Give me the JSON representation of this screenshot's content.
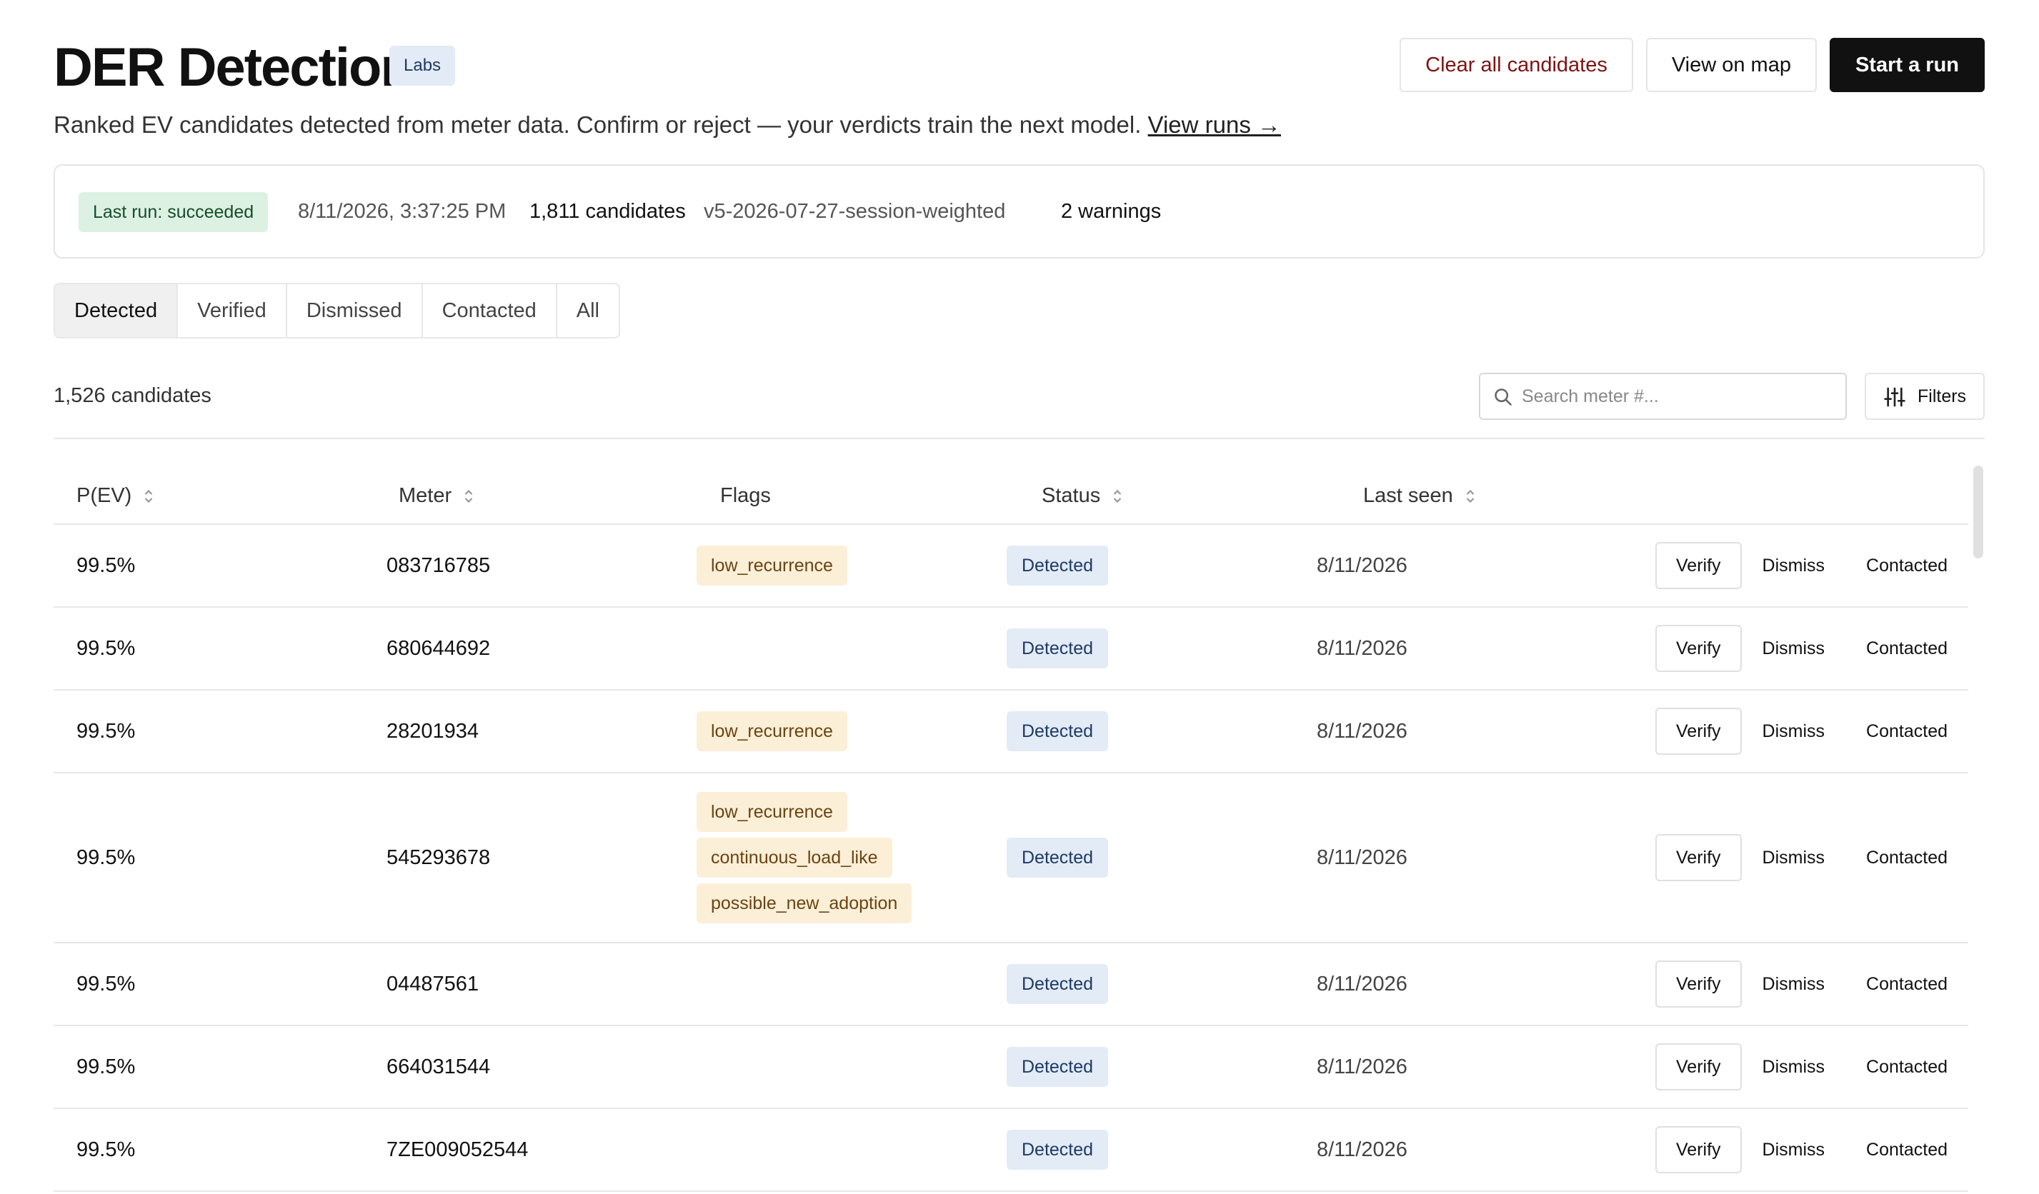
{
  "header": {
    "title": "DER Detection",
    "badge": "Labs",
    "actions": {
      "clear_all": "Clear all candidates",
      "view_map": "View on map",
      "start_run": "Start a run"
    }
  },
  "subtitle": {
    "text": "Ranked EV candidates detected from meter data. Confirm or reject — your verdicts train the next model.",
    "link": "View runs →"
  },
  "last_run": {
    "status": "Last run: succeeded",
    "datetime": "8/11/2026, 3:37:25 PM",
    "candidates": "1,811 candidates",
    "model": "v5-2026-07-27-session-weighted",
    "warnings": "2 warnings"
  },
  "tabs": [
    "Detected",
    "Verified",
    "Dismissed",
    "Contacted",
    "All"
  ],
  "active_tab": "Detected",
  "candidate_count": "1,526 candidates",
  "search": {
    "placeholder": "Search meter #..."
  },
  "filters_label": "Filters",
  "columns": {
    "p": "P(EV)",
    "meter": "Meter",
    "flags": "Flags",
    "status": "Status",
    "last_seen": "Last seen"
  },
  "row_actions": {
    "verify": "Verify",
    "dismiss": "Dismiss",
    "contacted": "Contacted"
  },
  "rows": [
    {
      "p": "99.5%",
      "meter": "083716785",
      "flags": [
        "low_recurrence"
      ],
      "status": "Detected",
      "last_seen": "8/11/2026"
    },
    {
      "p": "99.5%",
      "meter": "680644692",
      "flags": [],
      "status": "Detected",
      "last_seen": "8/11/2026"
    },
    {
      "p": "99.5%",
      "meter": "28201934",
      "flags": [
        "low_recurrence"
      ],
      "status": "Detected",
      "last_seen": "8/11/2026"
    },
    {
      "p": "99.5%",
      "meter": "545293678",
      "flags": [
        "low_recurrence",
        "continuous_load_like",
        "possible_new_adoption"
      ],
      "status": "Detected",
      "last_seen": "8/11/2026"
    },
    {
      "p": "99.5%",
      "meter": "04487561",
      "flags": [],
      "status": "Detected",
      "last_seen": "8/11/2026"
    },
    {
      "p": "99.5%",
      "meter": "664031544",
      "flags": [],
      "status": "Detected",
      "last_seen": "8/11/2026"
    },
    {
      "p": "99.5%",
      "meter": "7ZE009052544",
      "flags": [],
      "status": "Detected",
      "last_seen": "8/11/2026"
    }
  ]
}
